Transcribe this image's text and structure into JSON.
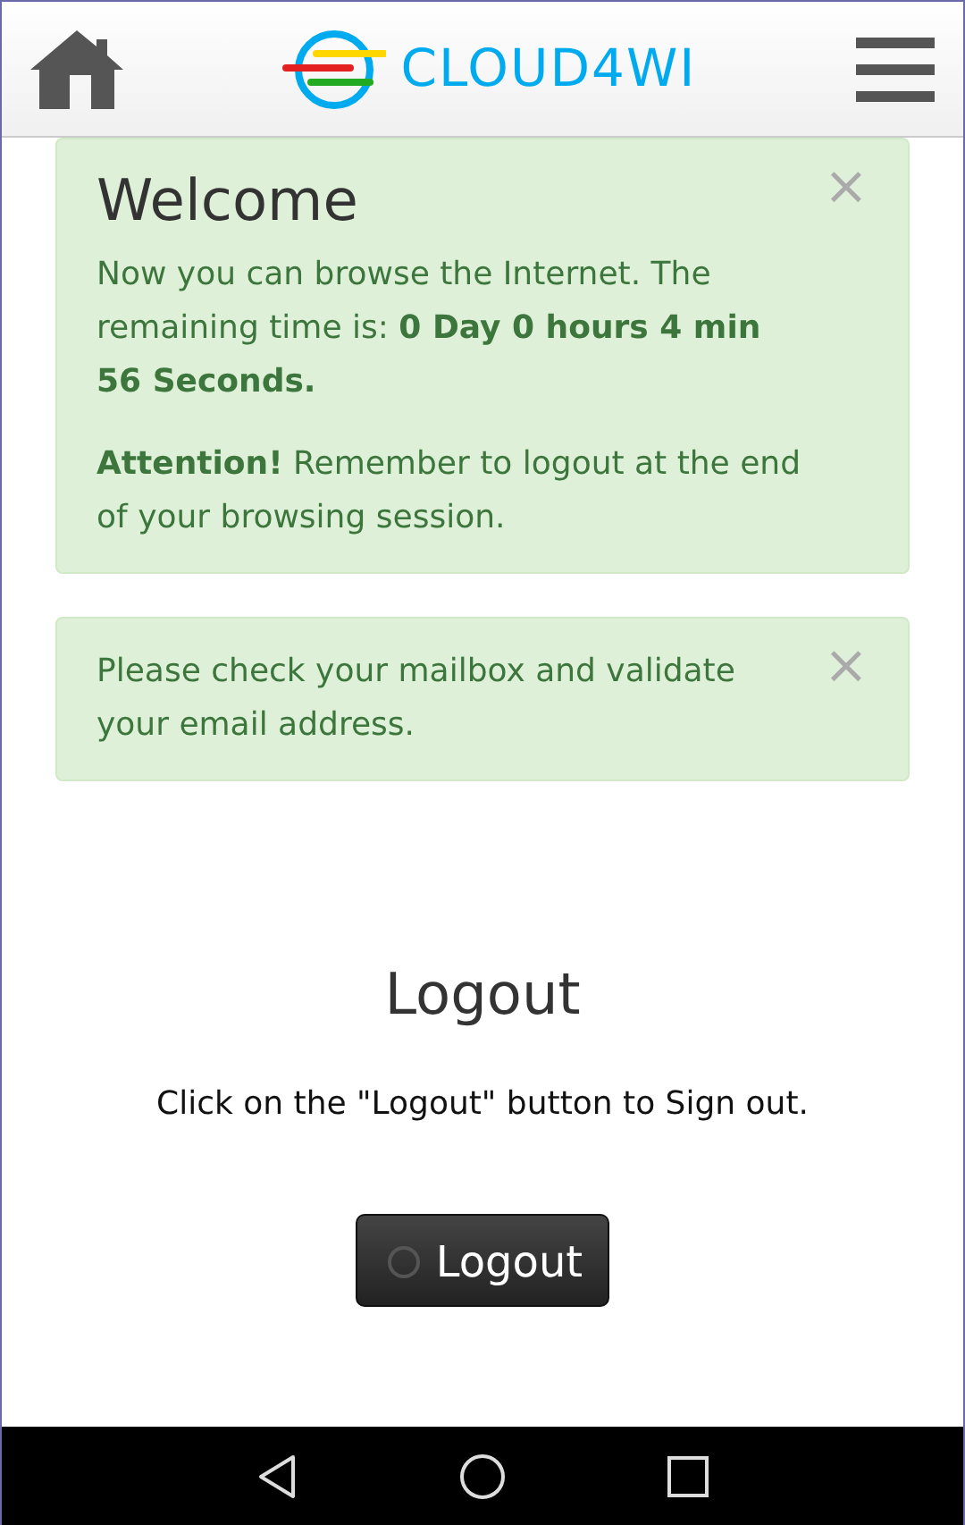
{
  "header": {
    "logo_text": "CLOUD4WI"
  },
  "alerts": [
    {
      "title": "Welcome",
      "paragraphs": [
        "Now you can browse the Internet. The remaining time is: **0 Day 0 hours 4 min 56 Seconds.**",
        "**Attention!** Remember to logout at the end of your browsing session."
      ],
      "close": "×"
    },
    {
      "paragraphs": [
        "Please check your mailbox and validate your email address."
      ],
      "close": "×"
    }
  ],
  "logout": {
    "heading": "Logout",
    "text": "Click on the \"Logout\" button to Sign out.",
    "button": "Logout"
  }
}
